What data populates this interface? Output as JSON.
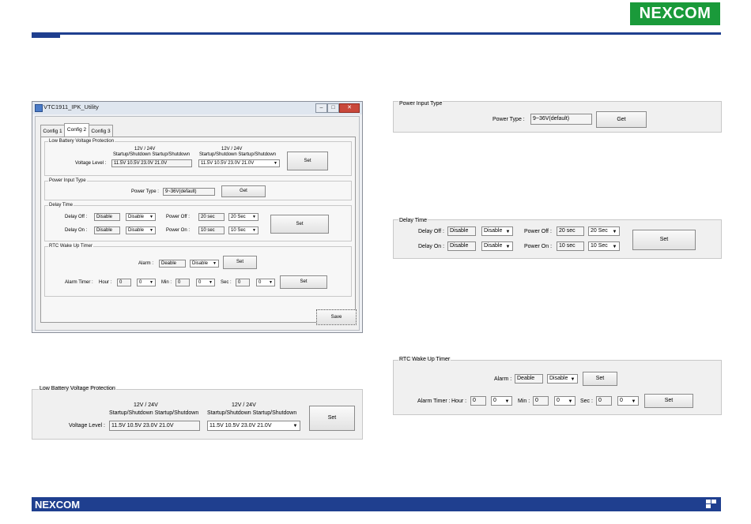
{
  "brand": {
    "logo_text": "NEXCOM",
    "footer_logo_text": "NEXCOM",
    "accent": "#1f3f8f",
    "logo_bg": "#1a9a3a"
  },
  "window": {
    "title": "VTC1911_IPK_Utility",
    "tabs": [
      "Config 1",
      "Config 2",
      "Config 3"
    ],
    "active_tab": "Config 2",
    "save_label": "Save"
  },
  "lbvp": {
    "legend": "Low Battery Voltage Protection",
    "col1_header": "12V / 24V",
    "col1_sub": "Startup/Shutdown Startup/Shutdown",
    "col2_header": "12V / 24V",
    "col2_sub": "Startup/Shutdown Startup/Shutdown",
    "voltage_label": "Voltage Level :",
    "voltage_value": "11.5V  10.5V   23.0V   21.0V",
    "voltage_select": "11.5V  10.5V   23.0V   21.0V",
    "set_label": "Set"
  },
  "power_input": {
    "legend": "Power Input Type",
    "type_label": "Power Type :",
    "type_value": "9~36V(default)",
    "get_label": "Get"
  },
  "delay": {
    "legend": "Delay Time",
    "off_label": "Delay Off :",
    "off_value": "Disable",
    "off_select": "Disable",
    "on_label": "Delay On :",
    "on_value": "Disable",
    "on_select": "Disable",
    "poweroff_label": "Power Off :",
    "poweroff_value": "20 sec",
    "poweroff_select": "20 Sec",
    "poweron_label": "Power On :",
    "poweron_value": "10 sec",
    "poweron_select": "10 Sec",
    "set_label": "Set"
  },
  "rtc": {
    "legend": "RTC Wake Up Timer",
    "alarm_label": "Alarm :",
    "alarm_value": "Deable",
    "alarm_select": "Disable",
    "alarm_set": "Set",
    "timer_label": "Alarm Timer :",
    "hour_label": "Hour :",
    "hour_value": "0",
    "hour_select": "0",
    "min_label": "Min :",
    "min_value": "0",
    "min_select": "0",
    "sec_label": "Sec :",
    "sec_value": "0",
    "sec_select": "0",
    "timer_set": "Set"
  }
}
